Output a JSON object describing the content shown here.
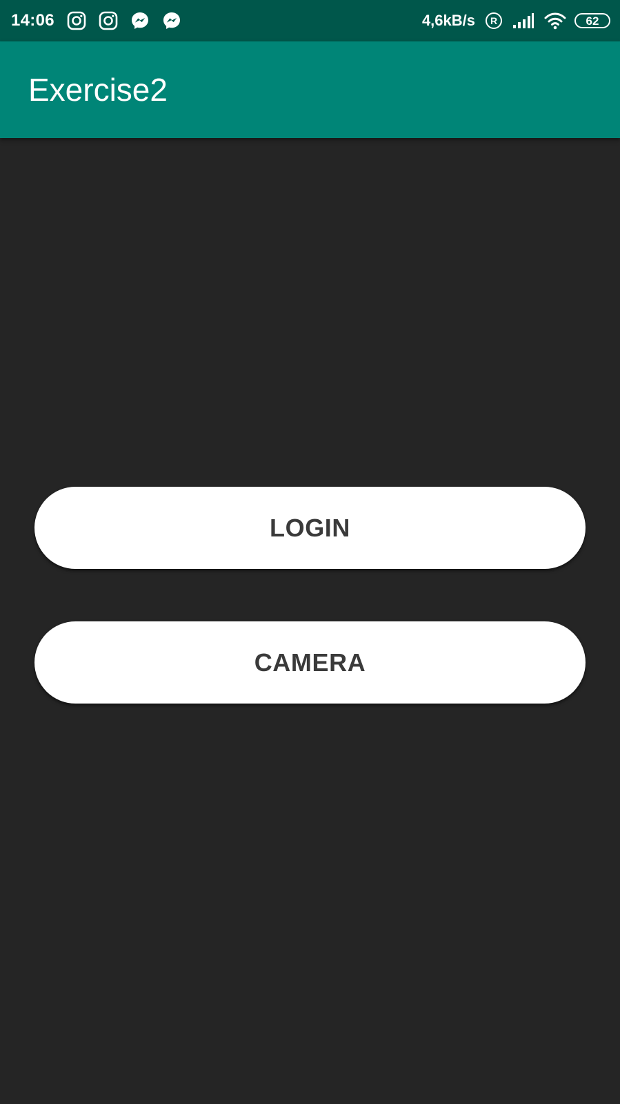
{
  "status_bar": {
    "time": "14:06",
    "notification_icons": [
      "instagram-icon",
      "instagram-icon",
      "messenger-icon",
      "messenger-icon"
    ],
    "network_speed": "4,6kB/s",
    "roaming_icon": "registered-icon",
    "signal_icon": "signal-icon",
    "wifi_icon": "wifi-icon",
    "battery_level": "62",
    "background_color": "#00574b"
  },
  "app_bar": {
    "title": "Exercise2",
    "background_color": "#008577"
  },
  "main": {
    "background_color": "#252525",
    "buttons": [
      {
        "label": "LOGIN"
      },
      {
        "label": "CAMERA"
      }
    ]
  }
}
